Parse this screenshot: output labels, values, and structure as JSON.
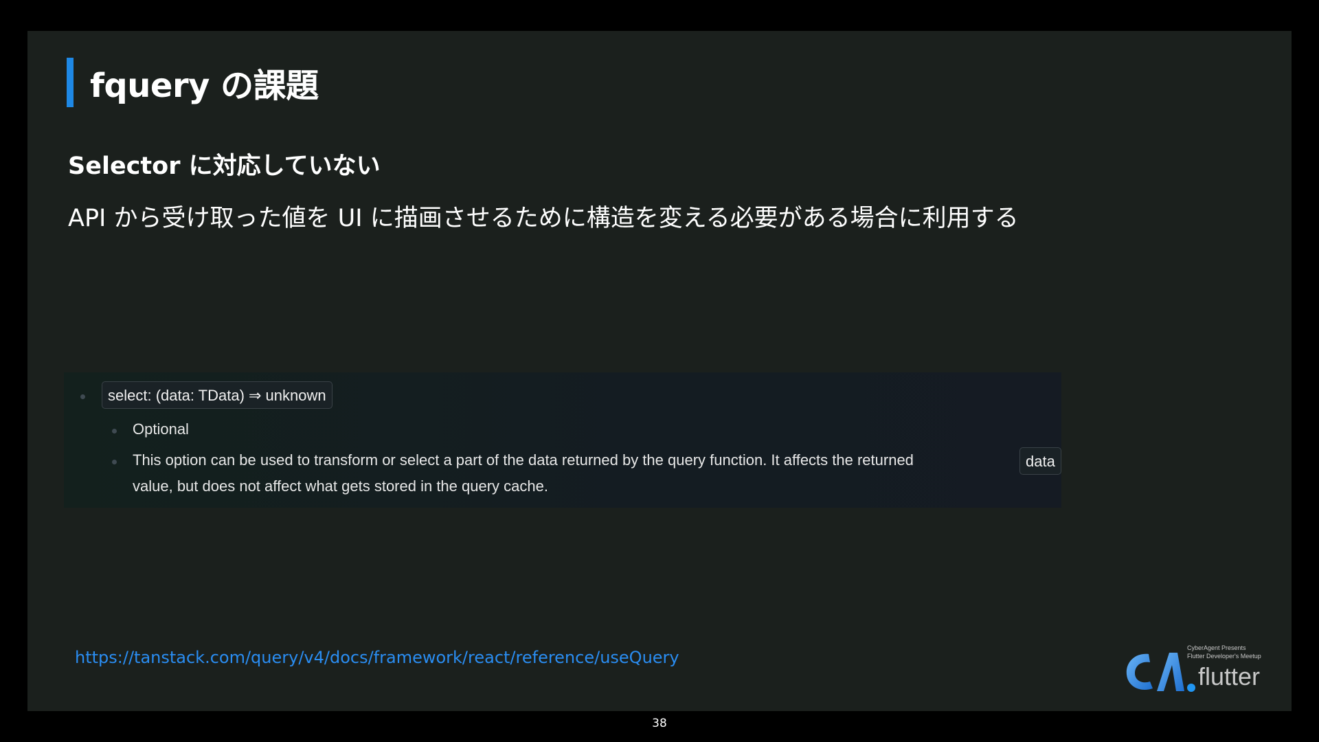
{
  "slide": {
    "title": "fquery の課題",
    "subtitle": "Selector に対応していない",
    "description": "API から受け取った値を UI に描画させるために構造を変える必要がある場合に利用する",
    "accent_color": "#1e88e5",
    "background_color": "#1b201d"
  },
  "doc": {
    "signature": "select: (data: TData) ⇒ unknown",
    "items": [
      "Optional",
      "This option can be used to transform or select a part of the data returned by the query function. It affects the returned",
      "value, but does not affect what gets stored in the query cache."
    ],
    "inline_code": "data"
  },
  "footer": {
    "link": "https://tanstack.com/query/v4/docs/framework/react/reference/useQuery",
    "link_color": "#2a8df2",
    "page_number": "38"
  },
  "logo": {
    "presents": "CyberAgent Presents",
    "meetup": "Flutter Developer's Meetup",
    "wordmark": "flutter",
    "icon": "ca-logo-icon"
  }
}
